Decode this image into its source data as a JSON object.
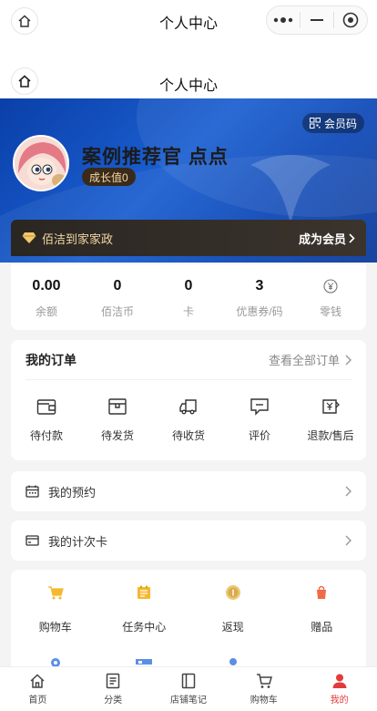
{
  "wechat_bar": {
    "title": "个人中心"
  },
  "nav": {
    "title": "个人中心"
  },
  "banner": {
    "member_code_label": "会员码",
    "user_name": "案例推荐官 点点",
    "growth_label": "成长值0"
  },
  "vip": {
    "text": "佰洁到家家政",
    "link_label": "成为会员"
  },
  "stats": [
    {
      "value": "0.00",
      "label": "余额"
    },
    {
      "value": "0",
      "label": "佰洁币"
    },
    {
      "value": "0",
      "label": "卡"
    },
    {
      "value": "3",
      "label": "优惠券/码"
    },
    {
      "value": "",
      "label": "零钱",
      "icon": "yen-circle-icon"
    }
  ],
  "orders": {
    "title": "我的订单",
    "view_all": "查看全部订单",
    "items": [
      {
        "label": "待付款",
        "icon": "wallet-icon"
      },
      {
        "label": "待发货",
        "icon": "box-icon"
      },
      {
        "label": "待收货",
        "icon": "truck-icon"
      },
      {
        "label": "评价",
        "icon": "comment-icon"
      },
      {
        "label": "退款/售后",
        "icon": "refund-icon"
      }
    ]
  },
  "appointment": {
    "label": "我的预约",
    "icon": "calendar-icon"
  },
  "time_card": {
    "label": "我的计次卡",
    "icon": "card-icon"
  },
  "services": [
    {
      "label": "购物车",
      "icon": "cart-icon",
      "color": "#f5b82e"
    },
    {
      "label": "任务中心",
      "icon": "task-icon",
      "color": "#f5b82e"
    },
    {
      "label": "返现",
      "icon": "coin-icon",
      "color": "#e8c06a"
    },
    {
      "label": "赠品",
      "icon": "gift-icon",
      "color": "#f06a4a"
    }
  ],
  "tabbar": [
    {
      "label": "首页",
      "icon": "home-icon",
      "active": false
    },
    {
      "label": "分类",
      "icon": "category-icon",
      "active": false
    },
    {
      "label": "店铺笔记",
      "icon": "notes-icon",
      "active": false
    },
    {
      "label": "购物车",
      "icon": "cart-icon",
      "active": false
    },
    {
      "label": "我的",
      "icon": "user-icon",
      "active": true
    }
  ],
  "colors": {
    "banner_blue": "#1b5fd1",
    "active_red": "#e33b3b",
    "vip_gold": "#f3d8a4"
  }
}
